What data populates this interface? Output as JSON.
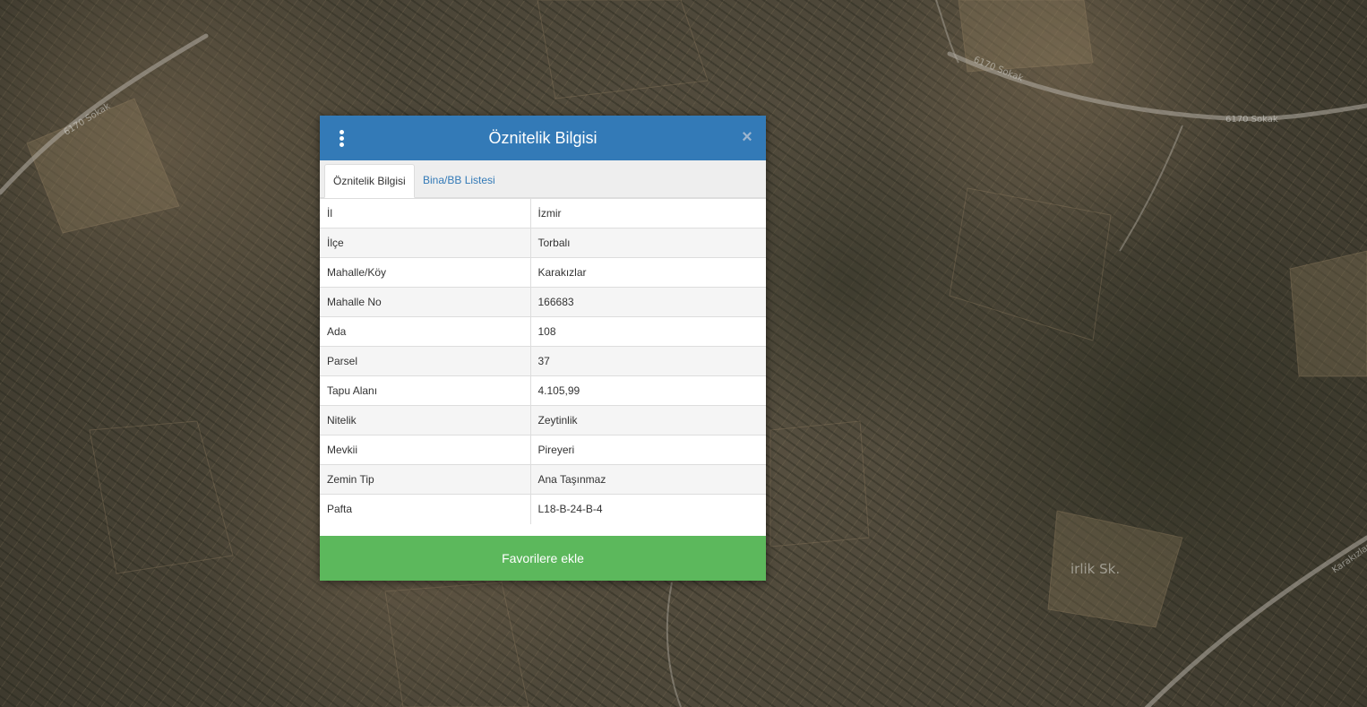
{
  "map": {
    "labels": [
      "6170 Sokak",
      "6170 Sokak",
      "6170 Sokak",
      "Karakızlar",
      "irlik Sk."
    ]
  },
  "dialog": {
    "title": "Öznitelik Bilgisi",
    "close_glyph": "×",
    "tabs": [
      {
        "label": "Öznitelik Bilgisi",
        "active": true
      },
      {
        "label": "Bina/BB Listesi",
        "active": false
      }
    ],
    "rows": [
      {
        "key": "İl",
        "value": "İzmir"
      },
      {
        "key": "İlçe",
        "value": "Torbalı"
      },
      {
        "key": "Mahalle/Köy",
        "value": "Karakızlar"
      },
      {
        "key": "Mahalle No",
        "value": "166683"
      },
      {
        "key": "Ada",
        "value": "108"
      },
      {
        "key": "Parsel",
        "value": "37"
      },
      {
        "key": "Tapu Alanı",
        "value": "4.105,99"
      },
      {
        "key": "Nitelik",
        "value": "Zeytinlik"
      },
      {
        "key": "Mevkii",
        "value": "Pireyeri"
      },
      {
        "key": "Zemin Tip",
        "value": "Ana Taşınmaz"
      },
      {
        "key": "Pafta",
        "value": "L18-B-24-B-4"
      }
    ],
    "favorite_button": "Favorilere ekle"
  },
  "colors": {
    "header": "#337ab7",
    "button": "#5cb85c",
    "link": "#337ab7"
  },
  "icons": {
    "menu": "kebab-menu-icon",
    "close": "close-icon"
  }
}
